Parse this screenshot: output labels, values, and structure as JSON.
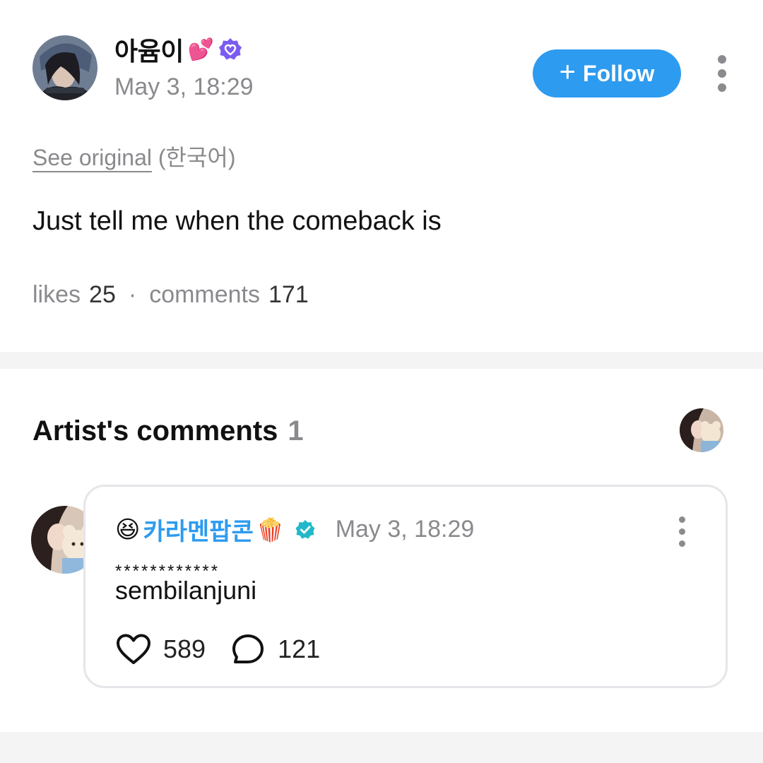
{
  "post": {
    "author_name": "아윰이",
    "author_emoji": "💕",
    "time": "May 3, 18:29",
    "follow_label": "Follow",
    "follow_plus": "+",
    "see_original": "See original",
    "language": "(한국어)",
    "text": "Just tell me when the comeback is",
    "likes_label": "likes",
    "likes": "25",
    "separator": "·",
    "comments_label": "comments",
    "comments": "171"
  },
  "artist_comments": {
    "title": "Artist's comments",
    "count": "1",
    "comment": {
      "emoji_prefix": "😆",
      "name": "카라멘팝콘",
      "emoji_suffix": "🍿",
      "time": "May 3, 18:29",
      "masked": "************",
      "text": "sembilanjuni",
      "likes": "589",
      "replies": "121"
    }
  },
  "colors": {
    "accent": "#2d9bf0",
    "verified_purple": "#7b5cf0",
    "verified_teal": "#21b8c9",
    "muted_text": "#8a8a8e",
    "page_background": "#f4f4f5"
  },
  "icons": {
    "verified": "verified-badge-icon",
    "more": "kebab-menu-icon",
    "like": "heart-outline-icon",
    "reply": "speech-bubble-icon"
  }
}
